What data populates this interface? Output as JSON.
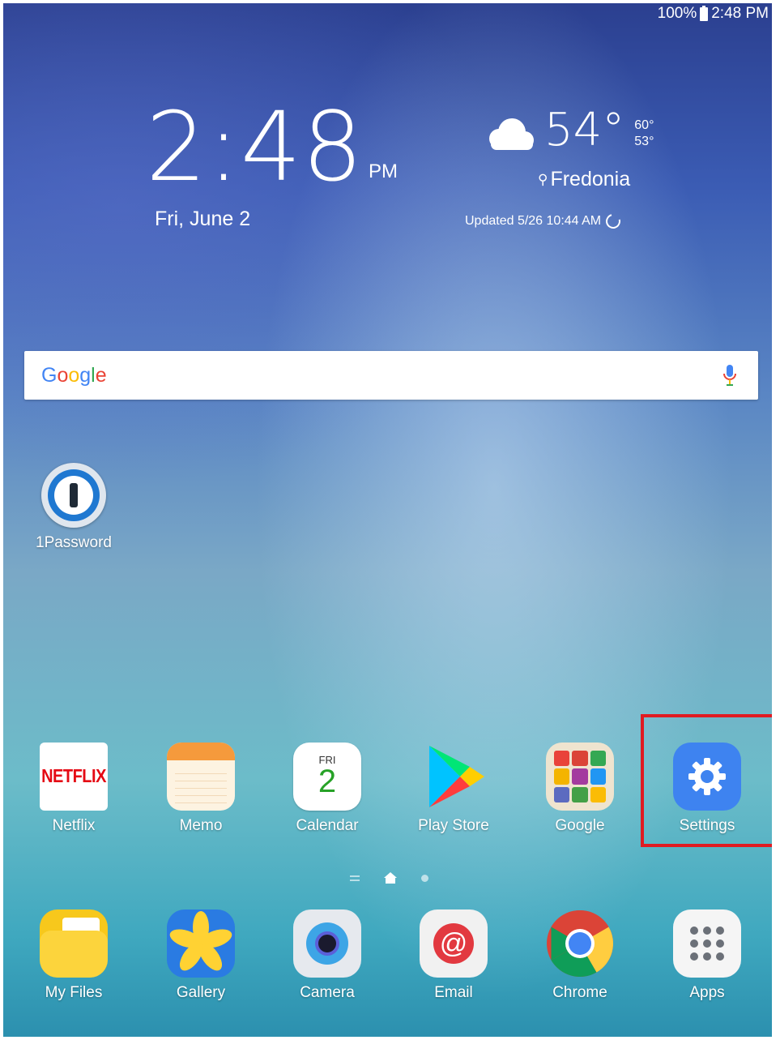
{
  "status_bar": {
    "battery": "100%",
    "time": "2:48 PM"
  },
  "clock_widget": {
    "time": "2:48",
    "ampm": "PM",
    "date": "Fri, June 2"
  },
  "weather_widget": {
    "temperature": "54°",
    "high": "60°",
    "low": "53°",
    "location": "Fredonia",
    "updated": "Updated 5/26 10:44 AM"
  },
  "search_bar": {
    "logo_letters": [
      "G",
      "o",
      "o",
      "g",
      "l",
      "e"
    ],
    "logo_colors": [
      "#4285F4",
      "#EA4335",
      "#FBBC05",
      "#4285F4",
      "#34A853",
      "#EA4335"
    ]
  },
  "home_apps": [
    {
      "label": "1Password",
      "icon": "1password-icon"
    }
  ],
  "app_row": [
    {
      "label": "Netflix",
      "icon": "netflix-icon",
      "icon_text": "NETFLIX"
    },
    {
      "label": "Memo",
      "icon": "memo-icon"
    },
    {
      "label": "Calendar",
      "icon": "calendar-icon",
      "day": "FRI",
      "date": "2"
    },
    {
      "label": "Play Store",
      "icon": "play-store-icon"
    },
    {
      "label": "Google",
      "icon": "google-folder-icon"
    },
    {
      "label": "Settings",
      "icon": "gear-icon"
    }
  ],
  "dock": [
    {
      "label": "My Files",
      "icon": "folder-icon"
    },
    {
      "label": "Gallery",
      "icon": "gallery-icon"
    },
    {
      "label": "Camera",
      "icon": "camera-icon"
    },
    {
      "label": "Email",
      "icon": "email-icon",
      "glyph": "@"
    },
    {
      "label": "Chrome",
      "icon": "chrome-icon"
    },
    {
      "label": "Apps",
      "icon": "apps-grid-icon"
    }
  ],
  "colors": {
    "highlight": "#e01b22",
    "settings_bg": "#3e83f0"
  }
}
